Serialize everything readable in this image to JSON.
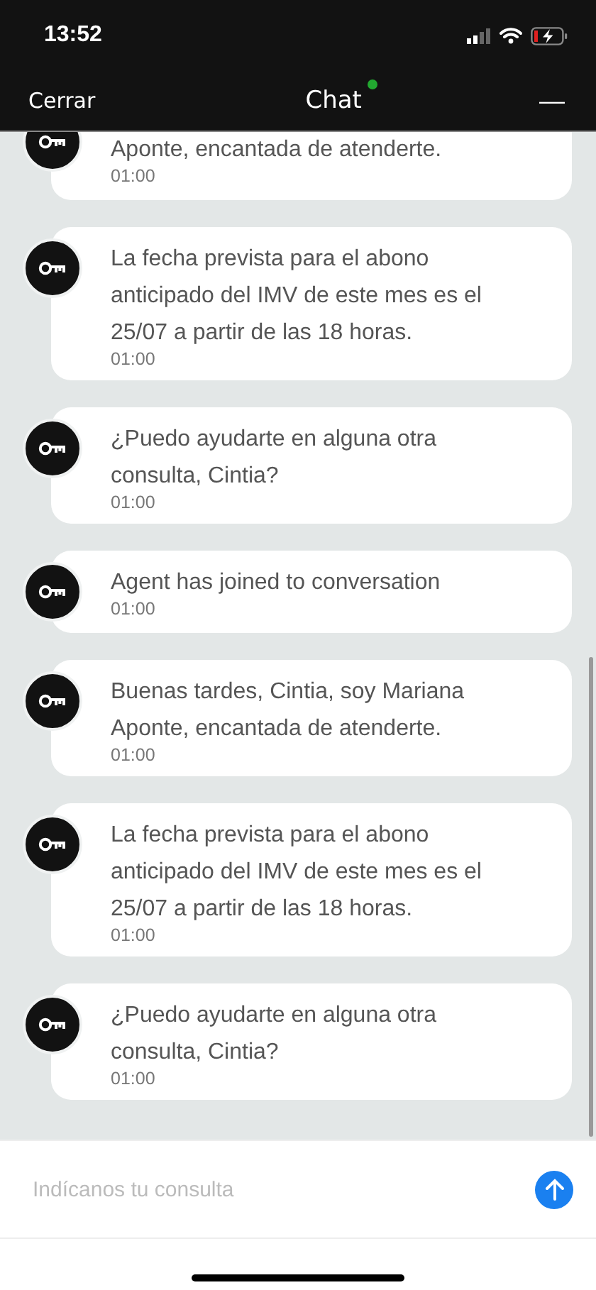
{
  "status_bar": {
    "time": "13:52"
  },
  "header": {
    "close": "Cerrar",
    "title": "Chat",
    "online": true,
    "minimize": "—"
  },
  "messages": [
    {
      "text": "Aponte, encantada de atenderte.",
      "time": "01:00"
    },
    {
      "text": "La fecha prevista para el abono anticipado del IMV de este mes es el 25/07 a partir de las 18 horas.",
      "time": "01:00"
    },
    {
      "text": "¿Puedo ayudarte en alguna otra consulta, Cintia?",
      "time": "01:00"
    },
    {
      "text": "Agent has joined to conversation",
      "time": "01:00"
    },
    {
      "text": "Buenas tardes, Cintia, soy Mariana Aponte, encantada de atenderte.",
      "time": "01:00"
    },
    {
      "text": "La fecha prevista para el abono anticipado del IMV de este mes es el 25/07 a partir de las 18 horas.",
      "time": "01:00"
    },
    {
      "text": "¿Puedo ayudarte en alguna otra consulta, Cintia?",
      "time": "01:00"
    }
  ],
  "composer": {
    "placeholder": "Indícanos tu consulta"
  }
}
